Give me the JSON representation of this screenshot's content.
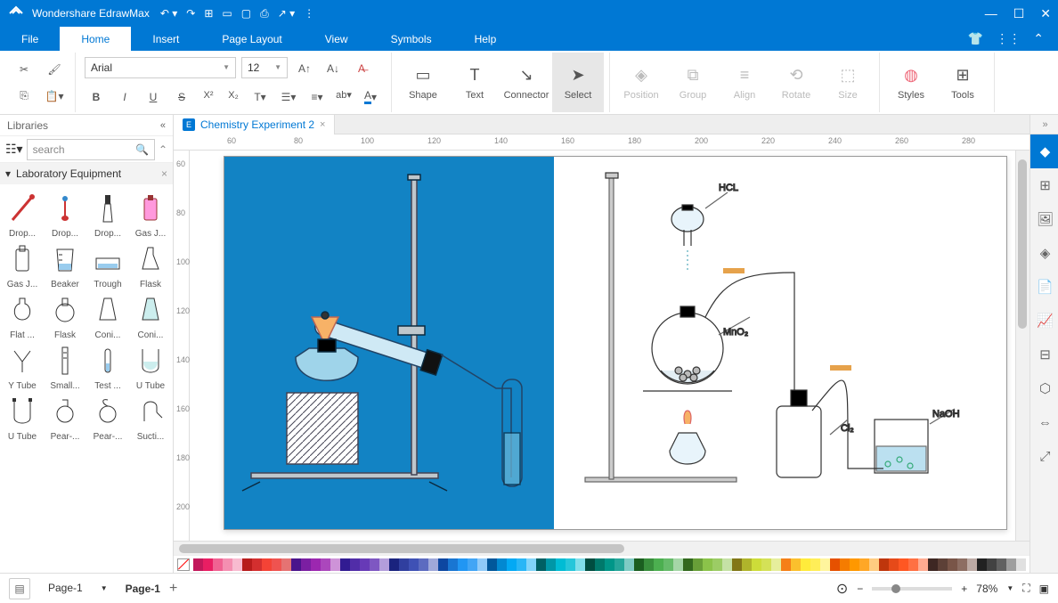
{
  "app": {
    "title": "Wondershare EdrawMax"
  },
  "menus": [
    "File",
    "Home",
    "Insert",
    "Page Layout",
    "View",
    "Symbols",
    "Help"
  ],
  "active_menu": "Home",
  "font": {
    "name": "Arial",
    "size": "12"
  },
  "ribbon_big": {
    "shape": "Shape",
    "text": "Text",
    "connector": "Connector",
    "select": "Select",
    "position": "Position",
    "group": "Group",
    "align": "Align",
    "rotate": "Rotate",
    "size": "Size",
    "styles": "Styles",
    "tools": "Tools"
  },
  "libraries": {
    "title": "Libraries",
    "search_placeholder": "search",
    "category": "Laboratory Equipment",
    "items": [
      "Drop...",
      "Drop...",
      "Drop...",
      "Gas J...",
      "Gas J...",
      "Beaker",
      "Trough",
      "Flask",
      "Flat ...",
      "Flask",
      "Coni...",
      "Coni...",
      "Y Tube",
      "Small...",
      "Test ...",
      "U Tube",
      "U Tube",
      "Pear-...",
      "Pear-...",
      "Sucti..."
    ]
  },
  "tab": {
    "label": "Chemistry Experiment 2"
  },
  "ruler_h": [
    "60",
    "80",
    "100",
    "120",
    "140",
    "160",
    "180",
    "200",
    "220",
    "240",
    "260",
    "280"
  ],
  "ruler_v": [
    "60",
    "80",
    "100",
    "120",
    "140",
    "160",
    "180",
    "200"
  ],
  "canvas_labels": {
    "hcl": "HCL",
    "mno2": "MnO₂",
    "naoh": "NaOH",
    "cl2": "Cl₂"
  },
  "status": {
    "page_sel": "Page-1",
    "page_tab": "Page-1",
    "zoom": "78%"
  },
  "palette_colors": [
    "#c2185b",
    "#e91e63",
    "#f06292",
    "#f48fb1",
    "#f8bbd0",
    "#b71c1c",
    "#d32f2f",
    "#f44336",
    "#ef5350",
    "#e57373",
    "#4a148c",
    "#7b1fa2",
    "#9c27b0",
    "#ab47bc",
    "#ce93d8",
    "#311b92",
    "#512da8",
    "#673ab7",
    "#7e57c2",
    "#b39ddb",
    "#1a237e",
    "#303f9f",
    "#3f51b5",
    "#5c6bc0",
    "#9fa8da",
    "#0d47a1",
    "#1976d2",
    "#2196f3",
    "#42a5f5",
    "#90caf9",
    "#01579b",
    "#0288d1",
    "#03a9f4",
    "#29b6f6",
    "#81d4fa",
    "#006064",
    "#0097a7",
    "#00bcd4",
    "#26c6da",
    "#80deea",
    "#004d40",
    "#00796b",
    "#009688",
    "#26a69a",
    "#80cbc4",
    "#1b5e20",
    "#388e3c",
    "#4caf50",
    "#66bb6a",
    "#a5d6a7",
    "#33691e",
    "#689f38",
    "#8bc34a",
    "#9ccc65",
    "#c5e1a5",
    "#827717",
    "#afb42b",
    "#cddc39",
    "#d4e157",
    "#e6ee9c",
    "#f57f17",
    "#fbc02d",
    "#ffeb3b",
    "#ffee58",
    "#fff59d",
    "#e65100",
    "#f57c00",
    "#ff9800",
    "#ffa726",
    "#ffcc80",
    "#bf360c",
    "#e64a19",
    "#ff5722",
    "#ff7043",
    "#ffab91",
    "#3e2723",
    "#5d4037",
    "#795548",
    "#8d6e63",
    "#bcaaa4",
    "#212121",
    "#424242",
    "#616161",
    "#9e9e9e",
    "#e0e0e0"
  ]
}
